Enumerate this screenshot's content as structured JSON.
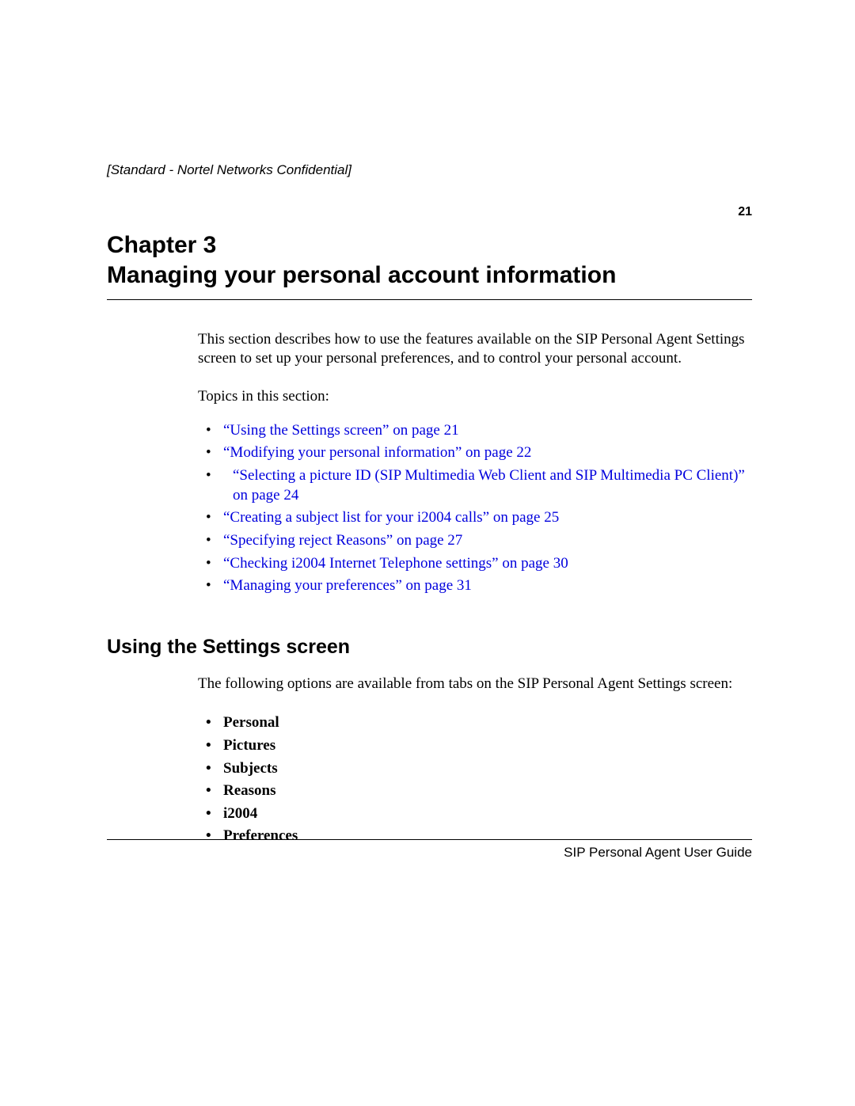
{
  "header": {
    "confidential": "[Standard - Nortel Networks Confidential]",
    "pageNumber": "21"
  },
  "chapter": {
    "line1": "Chapter 3",
    "line2": "Managing your personal account information"
  },
  "intro": "This section describes how to use the features available on the SIP Personal Agent Settings screen to set up your personal preferences, and to control your personal account.",
  "topicsLabel": "Topics in this section:",
  "topics": [
    "“Using the Settings screen” on page 21",
    "“Modifying your personal information” on page 22",
    "“Selecting a picture ID (SIP Multimedia Web Client and SIP Multimedia PC Client)” on page 24",
    "“Creating a subject list for your i2004 calls” on page 25",
    "“Specifying reject Reasons” on page 27",
    "“Checking i2004 Internet Telephone settings” on page 30",
    "“Managing your preferences” on page 31"
  ],
  "section": {
    "heading": "Using the Settings screen",
    "intro": "The following options are available from tabs on the SIP Personal Agent Settings screen:",
    "options": [
      "Personal",
      "Pictures",
      "Subjects",
      "Reasons",
      "i2004",
      "Preferences"
    ]
  },
  "footer": {
    "guide": "SIP Personal Agent User Guide"
  }
}
